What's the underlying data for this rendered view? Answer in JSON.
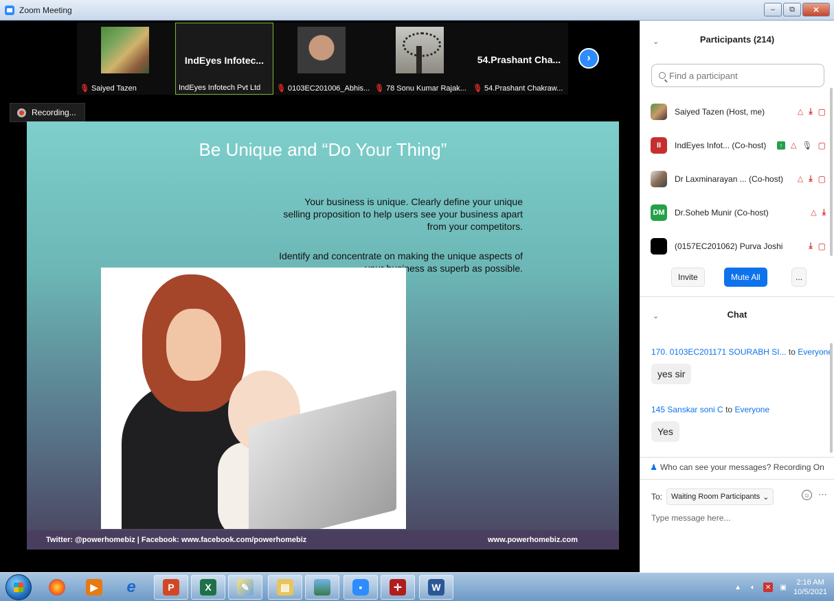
{
  "window": {
    "title": "Zoom Meeting"
  },
  "video_strip": {
    "tiles": [
      {
        "label": "Saiyed Tazen",
        "big_name": ""
      },
      {
        "label": "IndEyes Infotech Pvt Ltd",
        "big_name": "IndEyes Infotec..."
      },
      {
        "label": "0103EC201006_Abhis...",
        "big_name": ""
      },
      {
        "label": "78 Sonu Kumar Rajak...",
        "big_name": ""
      },
      {
        "label": "54.Prashant Chakraw...",
        "big_name": "54.Prashant Cha..."
      }
    ]
  },
  "recording": {
    "label": "Recording..."
  },
  "slide": {
    "title": "Be Unique and “Do Your Thing”",
    "paragraph1": "Your business is unique. Clearly define your unique selling proposition to help users see your business apart from your competitors.",
    "paragraph2": "Identify and concentrate on making the unique aspects of your business as superb as possible.",
    "footer_left": "Twitter: @powerhomebiz  |  Facebook: www.facebook.com/powerhomebiz",
    "footer_right": "www.powerhomebiz.com"
  },
  "participants": {
    "title": "Participants (214)",
    "search_placeholder": "Find a participant",
    "list": [
      {
        "name": "Saiyed Tazen (Host, me)",
        "avatar_text": ""
      },
      {
        "name": "IndEyes Infot...  (Co-host)",
        "avatar_text": "II"
      },
      {
        "name": "Dr Laxminarayan ...  (Co-host)",
        "avatar_text": ""
      },
      {
        "name": "Dr.Soheb Munir (Co-host)",
        "avatar_text": "DM"
      },
      {
        "name": "(0157EC201062) Purva Joshi",
        "avatar_text": ""
      }
    ],
    "buttons": {
      "invite": "Invite",
      "mute_all": "Mute All",
      "more": "..."
    }
  },
  "chat": {
    "title": "Chat",
    "messages": [
      {
        "from": "170. 0103EC201171 SOURABH SI...",
        "to_word": "to",
        "to": "Everyone",
        "text": "yes sir"
      },
      {
        "from": "145 Sanskar soni C",
        "to_word": "to",
        "to": "Everyone",
        "text": "Yes"
      }
    ],
    "privacy_note": "Who can see your messages? Recording On",
    "to_label": "To:",
    "to_value": "Waiting Room Participants",
    "input_placeholder": "Type message here..."
  },
  "taskbar": {
    "time": "2:16 AM",
    "date": "10/5/2021"
  },
  "colors": {
    "zoom_blue": "#0e72ed",
    "mute_red": "#d62727",
    "active_tile_border": "#7cba2f"
  }
}
